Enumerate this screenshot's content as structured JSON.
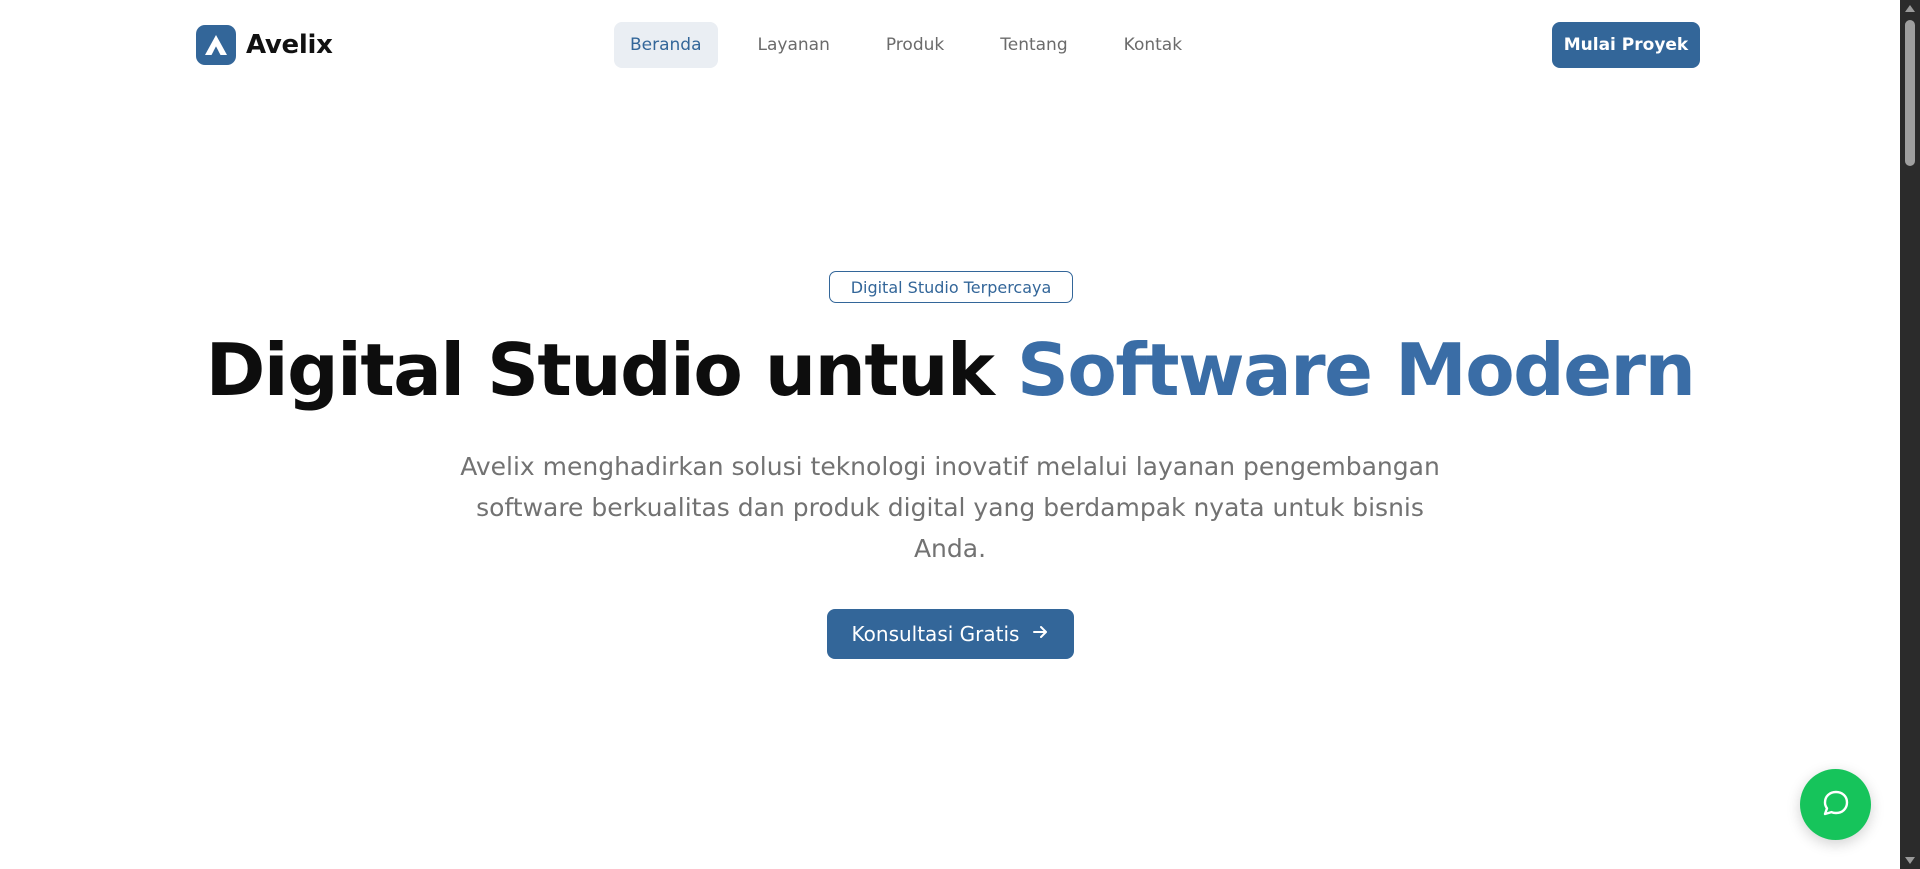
{
  "brand": {
    "name": "Avelix",
    "logo_icon": "avelix-a-logo-icon",
    "color": "#336699"
  },
  "nav": {
    "items": [
      {
        "label": "Beranda",
        "active": true
      },
      {
        "label": "Layanan",
        "active": false
      },
      {
        "label": "Produk",
        "active": false
      },
      {
        "label": "Tentang",
        "active": false
      },
      {
        "label": "Kontak",
        "active": false
      }
    ],
    "cta_label": "Mulai Proyek"
  },
  "hero": {
    "badge": "Digital Studio Terpercaya",
    "title_main": "Digital Studio untuk ",
    "title_accent": "Software Modern",
    "description": "Avelix menghadirkan solusi teknologi inovatif melalui layanan pengembangan software berkualitas dan produk digital yang berdampak nyata untuk bisnis Anda.",
    "cta_label": "Konsultasi Gratis",
    "cta_icon": "arrow-right-icon"
  },
  "floating": {
    "chat_icon": "chat-bubble-icon",
    "color": "#16c45b"
  }
}
